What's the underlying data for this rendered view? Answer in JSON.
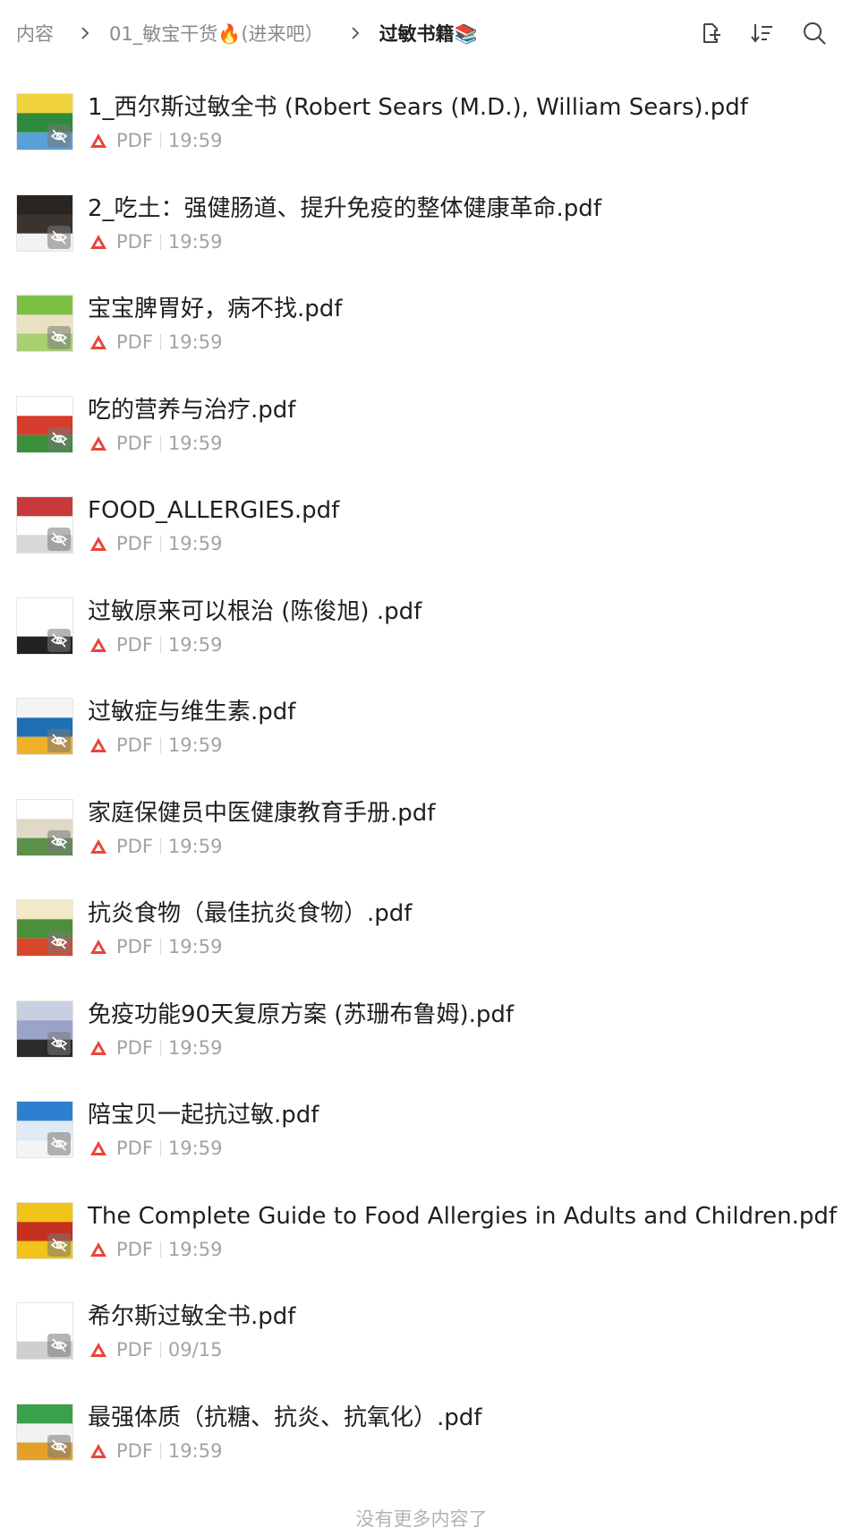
{
  "breadcrumb": {
    "root": "内容",
    "folder": "01_敏宝干货🔥(进来吧）",
    "current": "过敏书籍📚"
  },
  "toolbar": {
    "icons": [
      "new-folder-icon",
      "sort-icon",
      "search-icon"
    ]
  },
  "file_type_label": "PDF",
  "files": [
    {
      "name": "1_西尔斯过敏全书 (Robert Sears (M.D.), William Sears).pdf",
      "type": "PDF",
      "time": "19:59",
      "thumb_colors": [
        "#f0d23a",
        "#2e8b3d",
        "#5aa0d8"
      ]
    },
    {
      "name": "2_吃土：强健肠道、提升免疫的整体健康革命.pdf",
      "type": "PDF",
      "time": "19:59",
      "thumb_colors": [
        "#2a2522",
        "#3a332e",
        "#f2f2f2"
      ]
    },
    {
      "name": "宝宝脾胃好，病不找.pdf",
      "type": "PDF",
      "time": "19:59",
      "thumb_colors": [
        "#7cc043",
        "#e9e2c0",
        "#a8d070"
      ]
    },
    {
      "name": "吃的营养与治疗.pdf",
      "type": "PDF",
      "time": "19:59",
      "thumb_colors": [
        "#ffffff",
        "#d63b2b",
        "#3a8f3a"
      ]
    },
    {
      "name": "FOOD_ALLERGIES.pdf",
      "type": "PDF",
      "time": "19:59",
      "thumb_colors": [
        "#c83a3a",
        "#ffffff",
        "#d8d8d8"
      ]
    },
    {
      "name": "过敏原来可以根治 (陈俊旭) .pdf",
      "type": "PDF",
      "time": "19:59",
      "thumb_colors": [
        "#ffffff",
        "#ffffff",
        "#222222"
      ]
    },
    {
      "name": "过敏症与维生素.pdf",
      "type": "PDF",
      "time": "19:59",
      "thumb_colors": [
        "#f4f4f4",
        "#1f6fb5",
        "#f0b02a"
      ]
    },
    {
      "name": "家庭保健员中医健康教育手册.pdf",
      "type": "PDF",
      "time": "19:59",
      "thumb_colors": [
        "#ffffff",
        "#e0d9c8",
        "#5c8f4a"
      ]
    },
    {
      "name": "抗炎食物（最佳抗炎食物）.pdf",
      "type": "PDF",
      "time": "19:59",
      "thumb_colors": [
        "#f3e9c9",
        "#4b8f3a",
        "#d8472a"
      ]
    },
    {
      "name": "免疫功能90天复原方案 (苏珊布鲁姆).pdf",
      "type": "PDF",
      "time": "19:59",
      "thumb_colors": [
        "#c9cfe0",
        "#9aa4c8",
        "#2a2a2a"
      ]
    },
    {
      "name": "陪宝贝一起抗过敏.pdf",
      "type": "PDF",
      "time": "19:59",
      "thumb_colors": [
        "#2f7fd0",
        "#dfeaf5",
        "#f4f4f4"
      ]
    },
    {
      "name": "The Complete Guide to Food Allergies in Adults and Children.pdf",
      "type": "PDF",
      "time": "19:59",
      "thumb_colors": [
        "#f2c318",
        "#c6301f",
        "#f2c318"
      ]
    },
    {
      "name": "希尔斯过敏全书.pdf",
      "type": "PDF",
      "time": "09/15",
      "thumb_colors": [
        "#ffffff",
        "#ffffff",
        "#cfcfcf"
      ]
    },
    {
      "name": "最强体质（抗糖、抗炎、抗氧化）.pdf",
      "type": "PDF",
      "time": "19:59",
      "thumb_colors": [
        "#3aa04a",
        "#f2f2f2",
        "#e4a12a"
      ]
    }
  ],
  "footer": "没有更多内容了",
  "colors": {
    "pdf_red": "#e8453c",
    "muted_text": "#a3a3a3",
    "breadcrumb_gray": "#8a8a8a"
  }
}
